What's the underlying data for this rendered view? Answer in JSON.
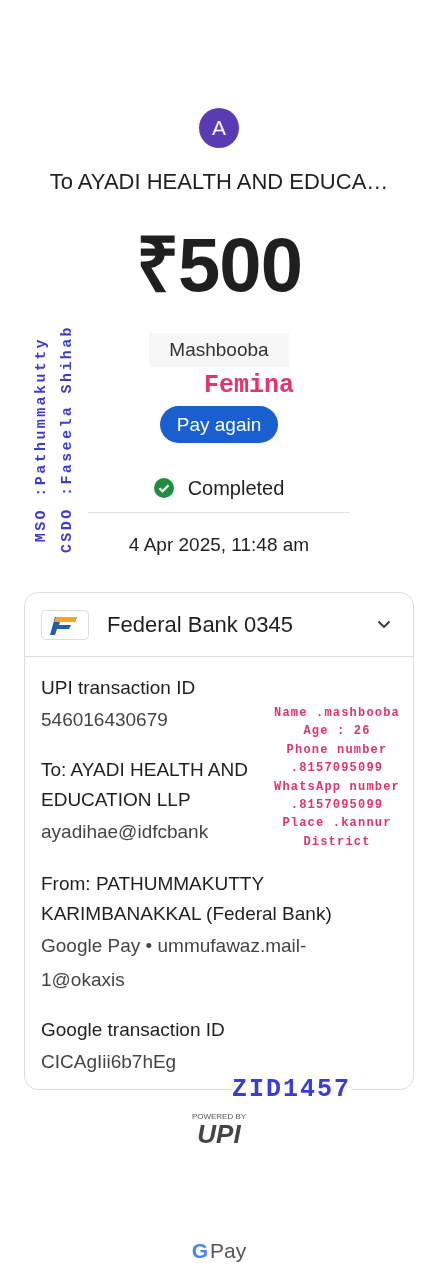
{
  "header": {
    "avatar_letter": "A",
    "title": "To AYADI HEALTH AND EDUCA…"
  },
  "amount": "₹500",
  "note": "Mashbooba",
  "pay_again": "Pay again",
  "status": {
    "kind": "completed",
    "label": "Completed"
  },
  "datetime": "4 Apr 2025, 11:48 am",
  "account": {
    "bank": "Federal Bank 0345"
  },
  "details": [
    {
      "label": "UPI transaction ID",
      "value": "546016430679"
    },
    {
      "label": "To: AYADI HEALTH AND EDUCATION LLP",
      "value": "ayadihae@idfcbank"
    },
    {
      "label": "From: PATHUMMAKUTTY KARIMBANAKKAL (Federal Bank)",
      "value": "Google Pay • ummufawaz.mail-1@okaxis"
    },
    {
      "label": "Google transaction ID",
      "value": "CICAgIii6b7hEg"
    }
  ],
  "powered_by": "POWERED BY",
  "upi_logo": "UPI",
  "footer": {
    "g": "G",
    "pay": "Pay"
  },
  "annotations": {
    "side": [
      "MSO :Pathummakutty",
      "CSDO :Faseela Shihab"
    ],
    "name_tag": "Femina",
    "info": [
      "Name .mashbooba",
      "Age : 26",
      "Phone number",
      ".8157095099",
      "WhatsApp number",
      ".8157095099",
      "Place .kannur",
      "District"
    ],
    "code": "ZID1457"
  }
}
